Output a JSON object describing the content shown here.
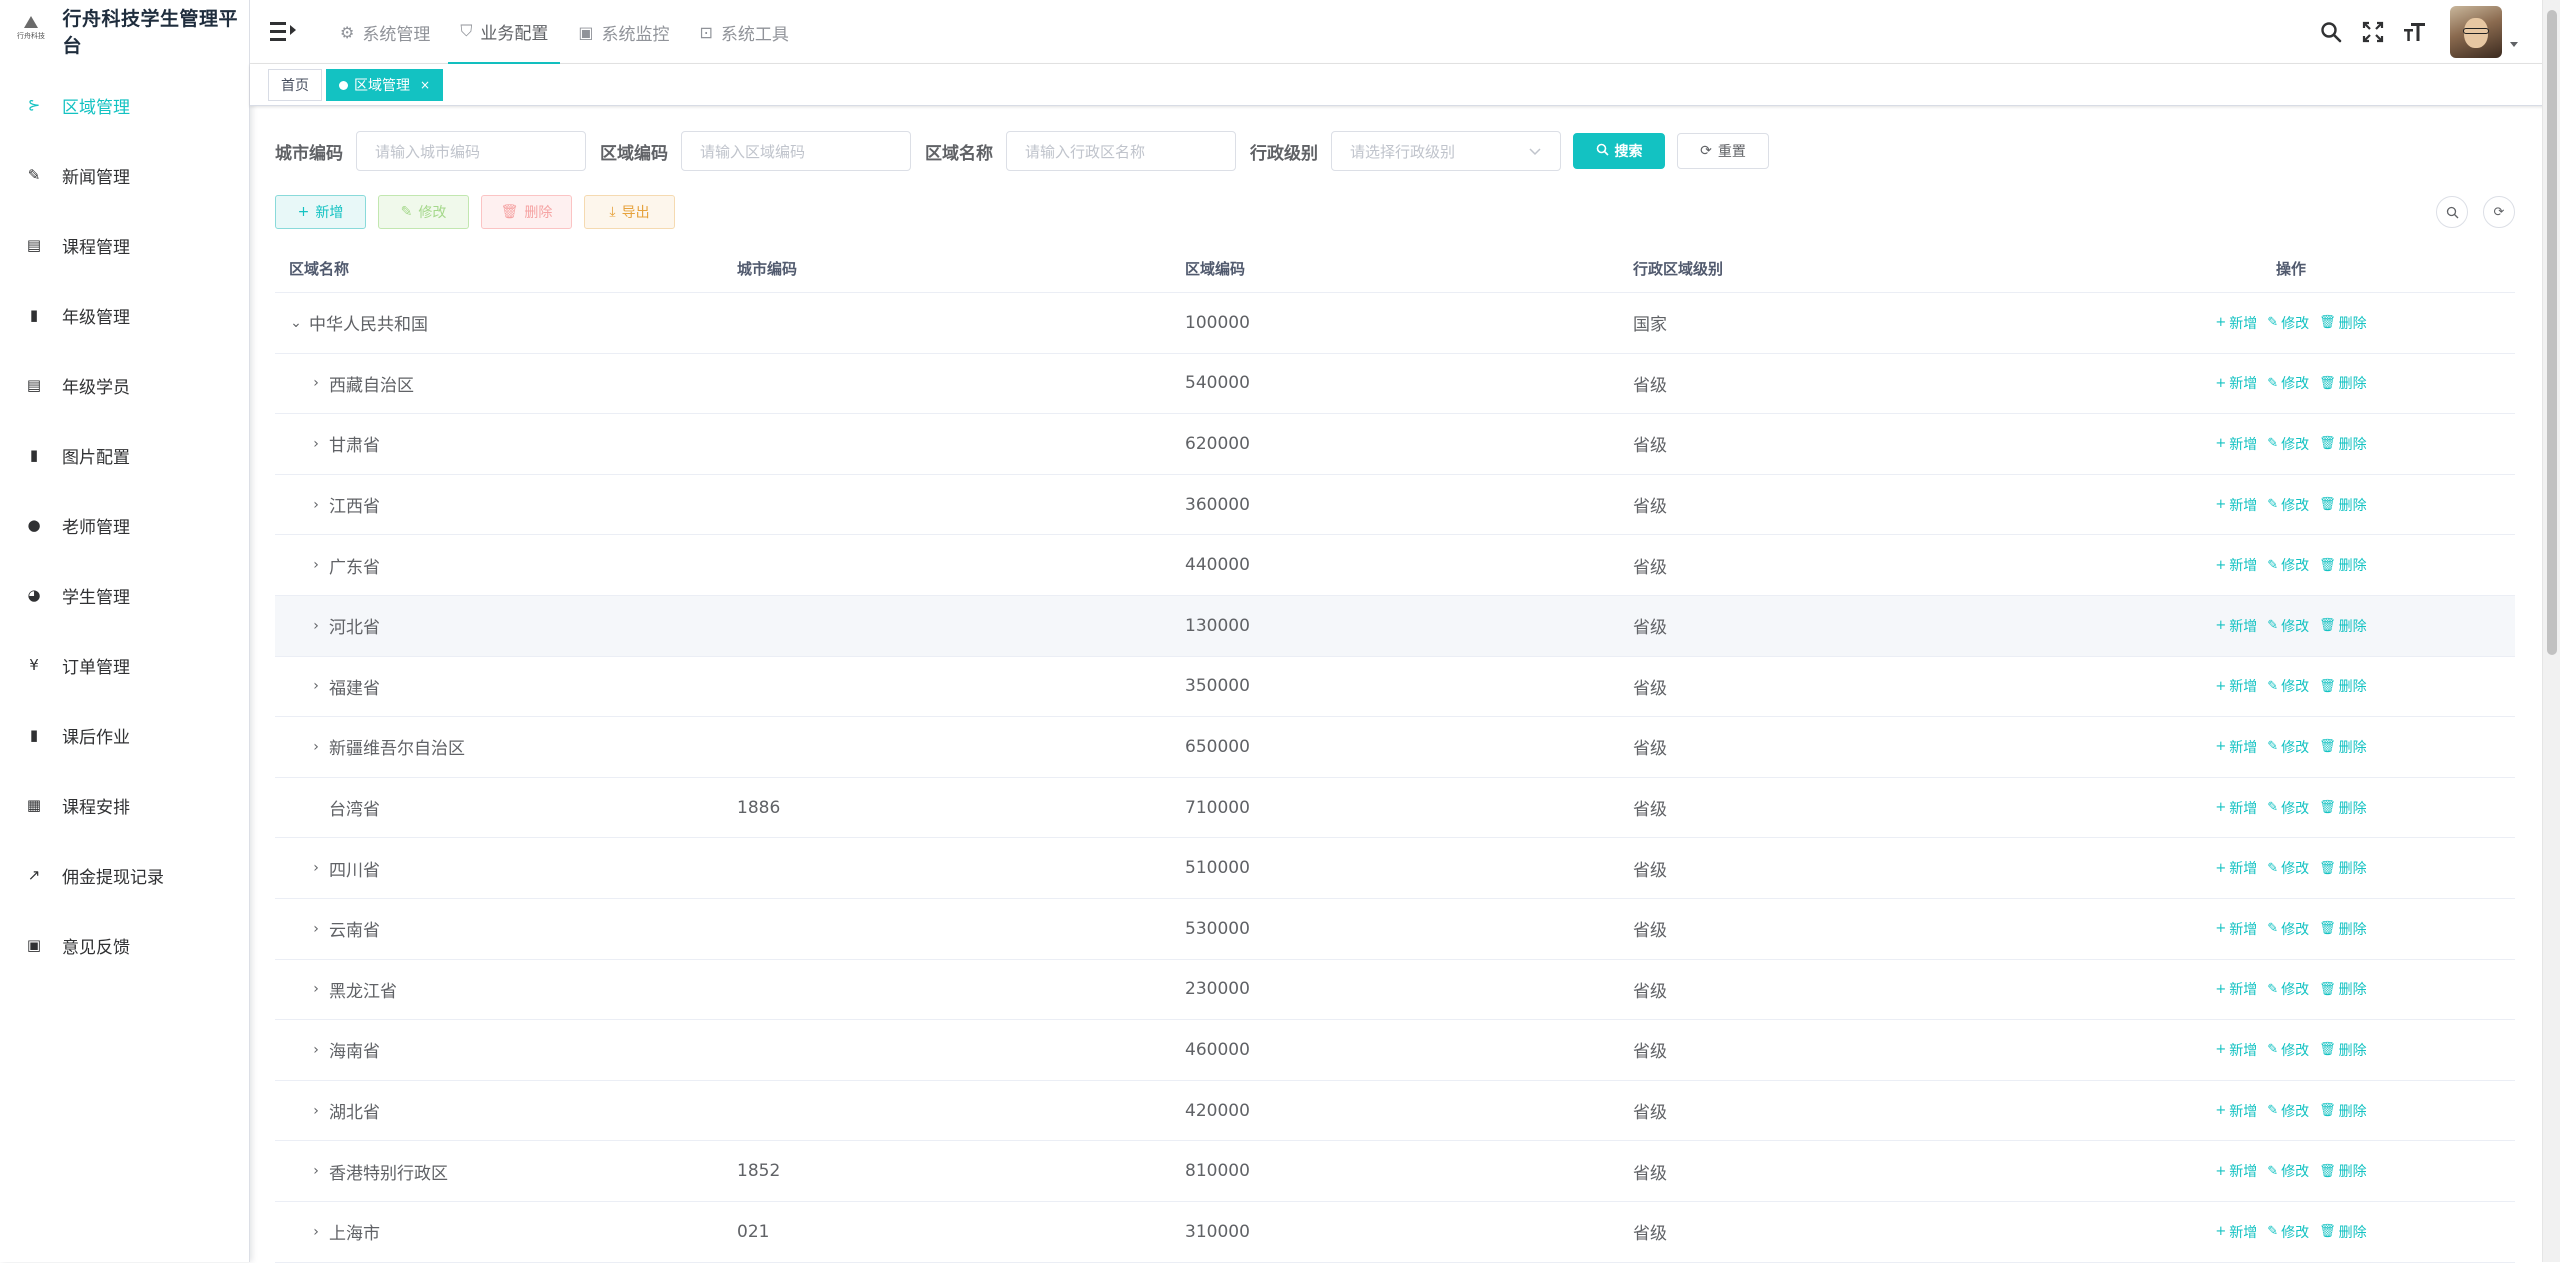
{
  "app": {
    "title": "行舟科技学生管理平台",
    "logo_caption": "行舟科技"
  },
  "sidebar": {
    "items": [
      {
        "label": "区域管理",
        "icon": "tree-icon",
        "active": true
      },
      {
        "label": "新闻管理",
        "icon": "edit-doc-icon"
      },
      {
        "label": "课程管理",
        "icon": "course-icon"
      },
      {
        "label": "年级管理",
        "icon": "grade-icon"
      },
      {
        "label": "年级学员",
        "icon": "doc-list-icon"
      },
      {
        "label": "图片配置",
        "icon": "image-config-icon"
      },
      {
        "label": "老师管理",
        "icon": "user-icon"
      },
      {
        "label": "学生管理",
        "icon": "people-icon"
      },
      {
        "label": "订单管理",
        "icon": "yuan-icon"
      },
      {
        "label": "课后作业",
        "icon": "book-icon"
      },
      {
        "label": "课程安排",
        "icon": "table-grid-icon"
      },
      {
        "label": "佣金提现记录",
        "icon": "external-link-icon"
      },
      {
        "label": "意见反馈",
        "icon": "clipboard-icon"
      }
    ]
  },
  "topnav": {
    "items": [
      {
        "label": "系统管理",
        "icon": "gear-icon"
      },
      {
        "label": "业务配置",
        "icon": "shield-icon",
        "active": true
      },
      {
        "label": "系统监控",
        "icon": "monitor-icon"
      },
      {
        "label": "系统工具",
        "icon": "toolbox-icon"
      }
    ]
  },
  "tags": {
    "home": "首页",
    "current": "区域管理",
    "close": "×"
  },
  "search": {
    "city_code_label": "城市编码",
    "city_code_placeholder": "请输入城市编码",
    "area_code_label": "区域编码",
    "area_code_placeholder": "请输入区域编码",
    "area_name_label": "区域名称",
    "area_name_placeholder": "请输入行政区名称",
    "level_label": "行政级别",
    "level_placeholder": "请选择行政级别",
    "search_btn": "搜索",
    "reset_btn": "重置"
  },
  "toolbar": {
    "add": "新增",
    "edit": "修改",
    "delete": "删除",
    "export": "导出"
  },
  "table": {
    "headers": {
      "name": "区域名称",
      "city_code": "城市编码",
      "area_code": "区域编码",
      "level": "行政区域级别",
      "ops": "操作"
    },
    "actions": {
      "add": "新增",
      "edit": "修改",
      "delete": "删除"
    },
    "rows": [
      {
        "name": "中华人民共和国",
        "city_code": "",
        "area_code": "100000",
        "level": "国家",
        "depth": 0,
        "expander": "open"
      },
      {
        "name": "西藏自治区",
        "city_code": "",
        "area_code": "540000",
        "level": "省级",
        "depth": 1,
        "expander": "closed"
      },
      {
        "name": "甘肃省",
        "city_code": "",
        "area_code": "620000",
        "level": "省级",
        "depth": 1,
        "expander": "closed"
      },
      {
        "name": "江西省",
        "city_code": "",
        "area_code": "360000",
        "level": "省级",
        "depth": 1,
        "expander": "closed"
      },
      {
        "name": "广东省",
        "city_code": "",
        "area_code": "440000",
        "level": "省级",
        "depth": 1,
        "expander": "closed"
      },
      {
        "name": "河北省",
        "city_code": "",
        "area_code": "130000",
        "level": "省级",
        "depth": 1,
        "expander": "closed",
        "hover": true
      },
      {
        "name": "福建省",
        "city_code": "",
        "area_code": "350000",
        "level": "省级",
        "depth": 1,
        "expander": "closed"
      },
      {
        "name": "新疆维吾尔自治区",
        "city_code": "",
        "area_code": "650000",
        "level": "省级",
        "depth": 1,
        "expander": "closed"
      },
      {
        "name": "台湾省",
        "city_code": "1886",
        "area_code": "710000",
        "level": "省级",
        "depth": 1,
        "expander": "none"
      },
      {
        "name": "四川省",
        "city_code": "",
        "area_code": "510000",
        "level": "省级",
        "depth": 1,
        "expander": "closed"
      },
      {
        "name": "云南省",
        "city_code": "",
        "area_code": "530000",
        "level": "省级",
        "depth": 1,
        "expander": "closed"
      },
      {
        "name": "黑龙江省",
        "city_code": "",
        "area_code": "230000",
        "level": "省级",
        "depth": 1,
        "expander": "closed"
      },
      {
        "name": "海南省",
        "city_code": "",
        "area_code": "460000",
        "level": "省级",
        "depth": 1,
        "expander": "closed"
      },
      {
        "name": "湖北省",
        "city_code": "",
        "area_code": "420000",
        "level": "省级",
        "depth": 1,
        "expander": "closed"
      },
      {
        "name": "香港特别行政区",
        "city_code": "1852",
        "area_code": "810000",
        "level": "省级",
        "depth": 1,
        "expander": "closed"
      },
      {
        "name": "上海市",
        "city_code": "021",
        "area_code": "310000",
        "level": "省级",
        "depth": 1,
        "expander": "closed"
      }
    ]
  },
  "colors": {
    "accent": "#13c2c2",
    "text": "#606266"
  }
}
